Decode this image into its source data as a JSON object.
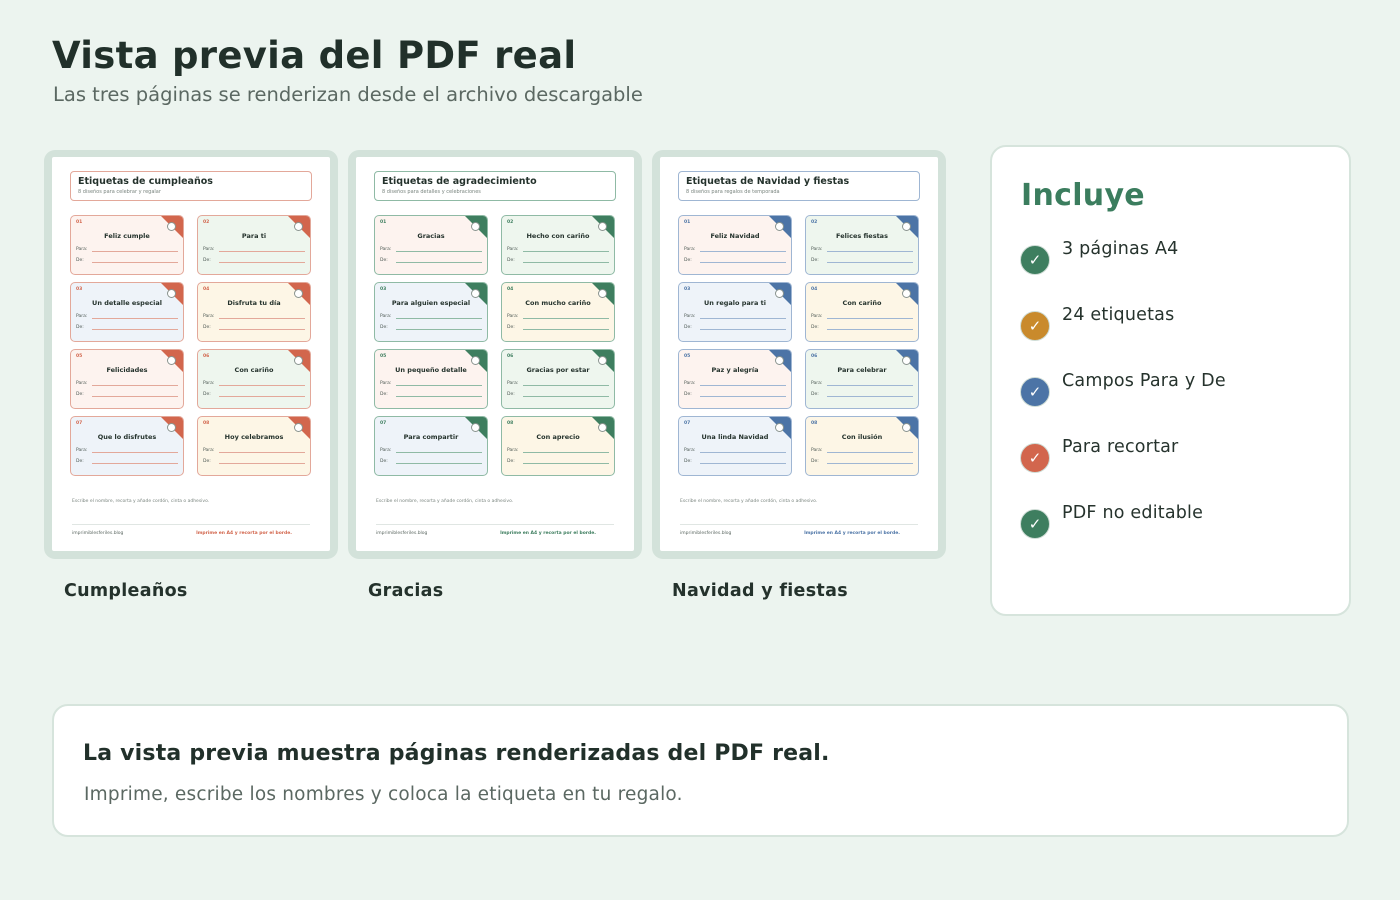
{
  "header": {
    "title": "Vista previa del PDF real",
    "subtitle": "Las tres páginas se renderizan desde el archivo descargable"
  },
  "pages": [
    {
      "caption": "Cumpleaños",
      "title": "Etiquetas de cumpleaños",
      "subtitle": "8 diseños para celebrar y regalar",
      "accent": "#d2664d",
      "header_border": "#e3a89a",
      "tags": [
        {
          "num": "01",
          "name": "Feliz cumple",
          "bg": "#fdf3ef"
        },
        {
          "num": "02",
          "name": "Para ti",
          "bg": "#eef6ee"
        },
        {
          "num": "03",
          "name": "Un detalle especial",
          "bg": "#eef3f9"
        },
        {
          "num": "04",
          "name": "Disfruta tu día",
          "bg": "#fdf6e6"
        },
        {
          "num": "05",
          "name": "Felicidades",
          "bg": "#fdf3ef"
        },
        {
          "num": "06",
          "name": "Con cariño",
          "bg": "#eef6ee"
        },
        {
          "num": "07",
          "name": "Que lo disfrutes",
          "bg": "#eef3f9"
        },
        {
          "num": "08",
          "name": "Hoy celebramos",
          "bg": "#fdf6e6"
        }
      ],
      "field_from": "Para:",
      "field_to": "De:",
      "instructions": "Escribe el nombre, recorta y añade cordón, cinta o adhesivo.",
      "site": "imprimiblesferiles.blog",
      "print_note": "Imprime en A4 y recorta por el borde."
    },
    {
      "caption": "Gracias",
      "title": "Etiquetas de agradecimiento",
      "subtitle": "8 diseños para detalles y celebraciones",
      "accent": "#3e7e5f",
      "header_border": "#8fbaa5",
      "tags": [
        {
          "num": "01",
          "name": "Gracias",
          "bg": "#fdf3ef"
        },
        {
          "num": "02",
          "name": "Hecho con cariño",
          "bg": "#eef6ee"
        },
        {
          "num": "03",
          "name": "Para alguien especial",
          "bg": "#eef3f9"
        },
        {
          "num": "04",
          "name": "Con mucho cariño",
          "bg": "#fdf6e6"
        },
        {
          "num": "05",
          "name": "Un pequeño detalle",
          "bg": "#fdf3ef"
        },
        {
          "num": "06",
          "name": "Gracias por estar",
          "bg": "#eef6ee"
        },
        {
          "num": "07",
          "name": "Para compartir",
          "bg": "#eef3f9"
        },
        {
          "num": "08",
          "name": "Con aprecio",
          "bg": "#fdf6e6"
        }
      ],
      "field_from": "Para:",
      "field_to": "De:",
      "instructions": "Escribe el nombre, recorta y añade cordón, cinta o adhesivo.",
      "site": "imprimiblesferiles.blog",
      "print_note": "Imprime en A4 y recorta por el borde."
    },
    {
      "caption": "Navidad y fiestas",
      "title": "Etiquetas de Navidad y fiestas",
      "subtitle": "8 diseños para regalos de temporada",
      "accent": "#4c74a6",
      "header_border": "#9fb6d3",
      "tags": [
        {
          "num": "01",
          "name": "Feliz Navidad",
          "bg": "#fdf3ef"
        },
        {
          "num": "02",
          "name": "Felices fiestas",
          "bg": "#eef6ee"
        },
        {
          "num": "03",
          "name": "Un regalo para ti",
          "bg": "#eef3f9"
        },
        {
          "num": "04",
          "name": "Con cariño",
          "bg": "#fdf6e6"
        },
        {
          "num": "05",
          "name": "Paz y alegría",
          "bg": "#fdf3ef"
        },
        {
          "num": "06",
          "name": "Para celebrar",
          "bg": "#eef6ee"
        },
        {
          "num": "07",
          "name": "Una linda Navidad",
          "bg": "#eef3f9"
        },
        {
          "num": "08",
          "name": "Con ilusión",
          "bg": "#fdf6e6"
        }
      ],
      "field_from": "Para:",
      "field_to": "De:",
      "instructions": "Escribe el nombre, recorta y añade cordón, cinta o adhesivo.",
      "site": "imprimiblesferiles.blog",
      "print_note": "Imprime en A4 y recorta por el borde."
    }
  ],
  "includes": {
    "title": "Incluye",
    "check_icon": "check-icon",
    "items": [
      {
        "label": "3 páginas A4",
        "color": "#3e7e5f"
      },
      {
        "label": "24 etiquetas",
        "color": "#c98a2c"
      },
      {
        "label": "Campos Para y De",
        "color": "#4c74a6"
      },
      {
        "label": "Para recortar",
        "color": "#d2664d"
      },
      {
        "label": "PDF no editable",
        "color": "#3e7e5f"
      }
    ]
  },
  "note": {
    "title": "La vista previa muestra páginas renderizadas del PDF real.",
    "text": "Imprime, escribe los nombres y coloca la etiqueta en tu regalo."
  }
}
